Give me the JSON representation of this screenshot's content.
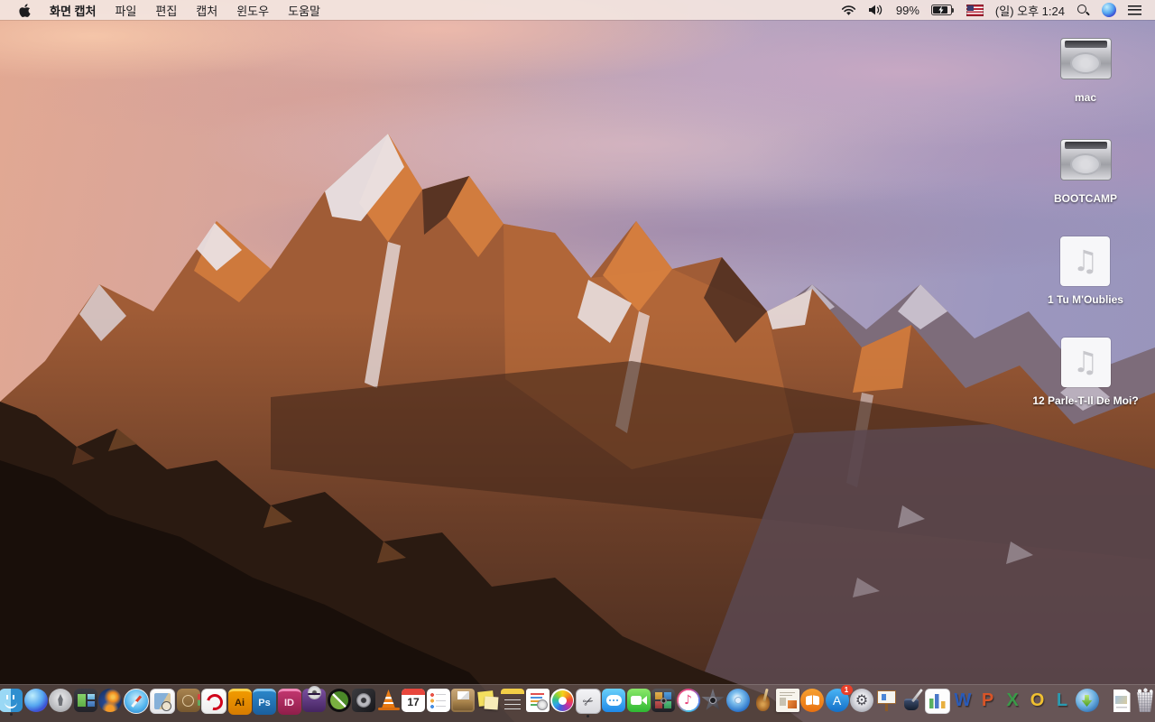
{
  "menu_bar": {
    "app_name": "화면 캡처",
    "menus": [
      "파일",
      "편집",
      "캡처",
      "윈도우",
      "도움말"
    ],
    "status": {
      "battery_percent": "99%",
      "battery_state": "charging",
      "input_source": "us-flag",
      "clock": "(일) 오후 1:24"
    },
    "status_icons": [
      "wifi-icon",
      "volume-icon",
      "battery-icon",
      "input-source-flag-icon",
      "spotlight-search-icon",
      "siri-icon",
      "notification-center-icon"
    ]
  },
  "desktop": {
    "wallpaper": "macos-sierra-mountain-sunset",
    "icons": [
      {
        "label": "mac",
        "type": "hard-drive"
      },
      {
        "label": "BOOTCAMP",
        "type": "hard-drive"
      },
      {
        "label": "1 Tu M'Oublies",
        "type": "audio-file",
        "glyph": "♫"
      },
      {
        "label": "12 Parle-T-Il De Moi?",
        "type": "audio-file",
        "glyph": "♫"
      }
    ]
  },
  "dock": {
    "items": [
      {
        "name": "finder",
        "kind": "finder",
        "running": true
      },
      {
        "name": "siri",
        "kind": "siri"
      },
      {
        "name": "launchpad",
        "kind": "launchpad"
      },
      {
        "name": "mission-control",
        "kind": "mission-control"
      },
      {
        "name": "firefox",
        "kind": "firefox"
      },
      {
        "name": "safari",
        "kind": "safari"
      },
      {
        "name": "preview",
        "kind": "preview"
      },
      {
        "name": "leather-book-organizer",
        "kind": "leather-book"
      },
      {
        "name": "acrobat-reader",
        "kind": "acrobat"
      },
      {
        "name": "adobe-illustrator",
        "kind": "adobe-ai",
        "glyph": "Ai"
      },
      {
        "name": "adobe-photoshop",
        "kind": "adobe-ps",
        "glyph": "Ps"
      },
      {
        "name": "adobe-indesign",
        "kind": "adobe-id",
        "glyph": "ID"
      },
      {
        "name": "toast-titanium",
        "kind": "toast"
      },
      {
        "name": "xee-image-viewer",
        "kind": "xee"
      },
      {
        "name": "disk-utility-app",
        "kind": "disk-fan"
      },
      {
        "name": "vlc",
        "kind": "vlc"
      },
      {
        "name": "calendar",
        "kind": "calendar",
        "glyph": "17"
      },
      {
        "name": "reminders",
        "kind": "reminders"
      },
      {
        "name": "unarchiver",
        "kind": "unarchiver"
      },
      {
        "name": "stickies",
        "kind": "stickies"
      },
      {
        "name": "notes",
        "kind": "notes"
      },
      {
        "name": "installer-document-app",
        "kind": "installer-doc"
      },
      {
        "name": "photos",
        "kind": "photos"
      },
      {
        "name": "grab-screen-capture",
        "kind": "grab",
        "glyph": "✂",
        "running": true
      },
      {
        "name": "messages",
        "kind": "messages"
      },
      {
        "name": "facetime",
        "kind": "facetime"
      },
      {
        "name": "photo-booth",
        "kind": "photobooth"
      },
      {
        "name": "itunes",
        "kind": "itunes",
        "glyph": "♪"
      },
      {
        "name": "imovie",
        "kind": "imovie"
      },
      {
        "name": "idvd",
        "kind": "idvd"
      },
      {
        "name": "garageband",
        "kind": "garageband"
      },
      {
        "name": "scrapbook-collage-app",
        "kind": "scrapbook"
      },
      {
        "name": "ibooks",
        "kind": "ibooks"
      },
      {
        "name": "app-store",
        "kind": "appstore",
        "glyph": "A",
        "badge": "1"
      },
      {
        "name": "system-preferences",
        "kind": "sysprefs",
        "glyph": "⚙"
      },
      {
        "name": "keynote",
        "kind": "keynote"
      },
      {
        "name": "pages",
        "kind": "pages"
      },
      {
        "name": "numbers",
        "kind": "numbers"
      },
      {
        "name": "microsoft-word",
        "kind": "office-w",
        "glyph": "W"
      },
      {
        "name": "microsoft-powerpoint",
        "kind": "office-p",
        "glyph": "P"
      },
      {
        "name": "microsoft-excel",
        "kind": "office-x",
        "glyph": "X"
      },
      {
        "name": "microsoft-outlook",
        "kind": "office-o",
        "glyph": "O"
      },
      {
        "name": "microsoft-lync",
        "kind": "office-l",
        "glyph": "L"
      },
      {
        "name": "download-manager",
        "kind": "download-globe"
      },
      {
        "name": "separator",
        "kind": "separator"
      },
      {
        "name": "image-document-file",
        "kind": "docfile"
      },
      {
        "name": "trash-full",
        "kind": "trash"
      }
    ]
  },
  "colors": {
    "menubar_bg": "#f3e5e0",
    "dock_bg": "rgba(116,101,99,0.55)",
    "badge_red": "#e8402a",
    "sky_pink": "#e2a892",
    "sky_purple": "#9c97bf",
    "mountain_sunlit": "#d9813f",
    "mountain_shadow": "#452a1e"
  }
}
